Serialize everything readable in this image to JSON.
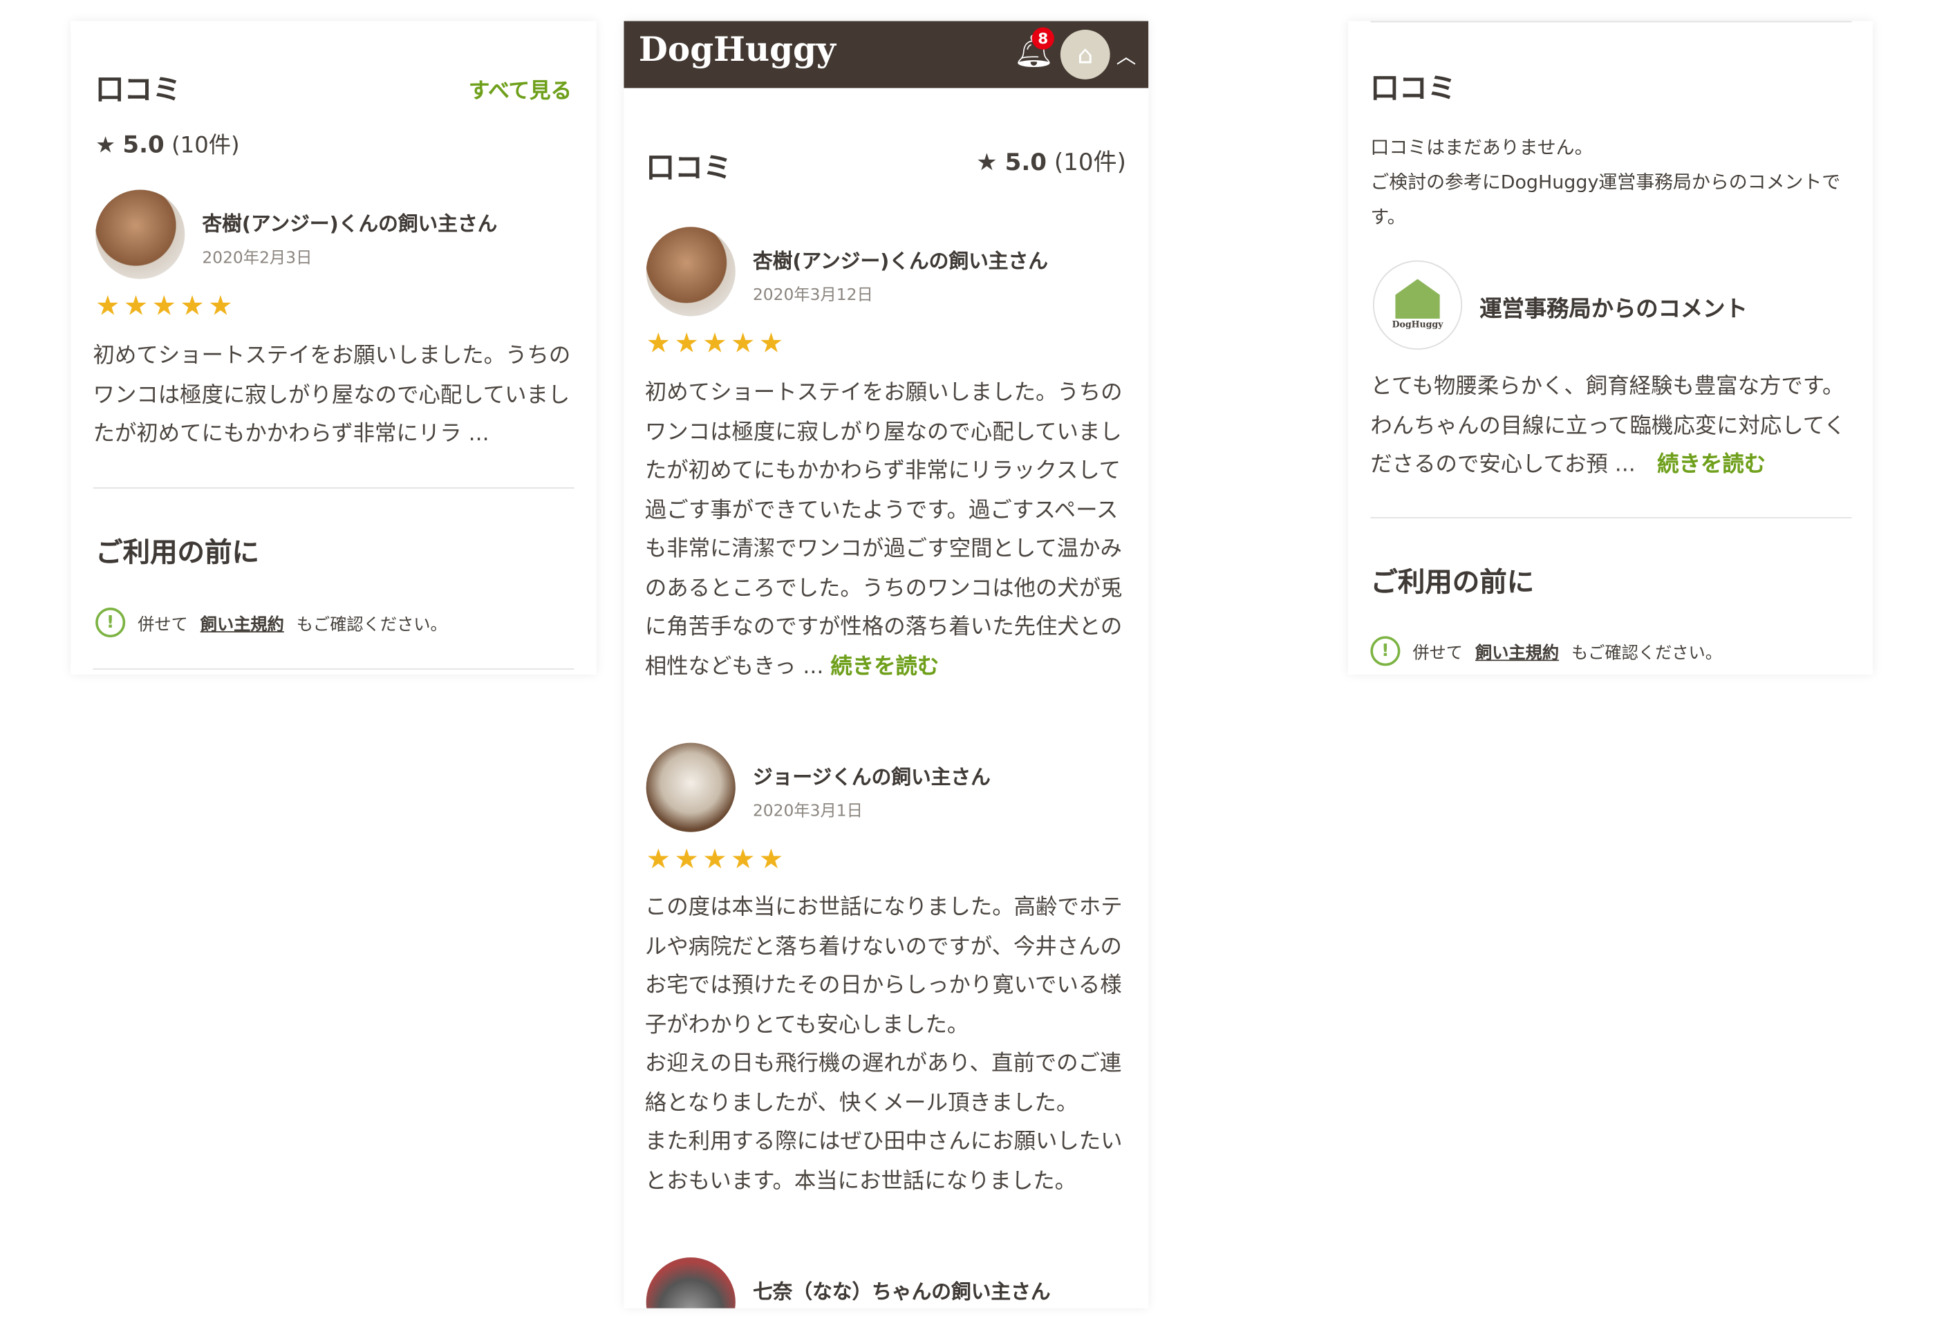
{
  "left": {
    "title": "口コミ",
    "see_all": "すべて見る",
    "rating": "5.0",
    "count": "(10件)",
    "review": {
      "name": "杏樹(アンジー)くんの飼い主さん",
      "date": "2020年2月3日",
      "stars": "★★★★★",
      "text": "初めてショートステイをお願いしました。うちのワンコは極度に寂しがり屋なので心配していましたが初めてにもかかわらず非常にリラ ..."
    },
    "before_title": "ご利用の前に",
    "notice": {
      "prefix": "併せて",
      "link": "飼い主規約",
      "suffix": "もご確認ください。"
    }
  },
  "middle": {
    "logo": "DogHuggy",
    "notification_count": "8",
    "title": "口コミ",
    "rating": "5.0",
    "count": "(10件)",
    "reviews": [
      {
        "name": "杏樹(アンジー)くんの飼い主さん",
        "date": "2020年3月12日",
        "stars": "★★★★★",
        "text": "初めてショートステイをお願いしました。うちのワンコは極度に寂しがり屋なので心配していましたが初めてにもかかわらず非常にリラックスして過ごす事ができていたようです。過ごすスペースも非常に清潔でワンコが過ごす空間として温かみのあるところでした。うちのワンコは他の犬が兎に角苦手なのですが性格の落ち着いた先住犬との相性などもきっ ...",
        "more": "続きを読む"
      },
      {
        "name": "ジョージくんの飼い主さん",
        "date": "2020年3月1日",
        "stars": "★★★★★",
        "text": "この度は本当にお世話になりました。高齢でホテルや病院だと落ち着けないのですが、今井さんのお宅では預けたその日からしっかり寛いでいる様子がわかりとても安心しました。\nお迎えの日も飛行機の遅れがあり、直前でのご連絡となりましたが、快くメール頂きました。\nまた利用する際にはぜひ田中さんにお願いしたいとおもいます。本当にお世話になりました。"
      },
      {
        "name": "七奈（なな）ちゃんの飼い主さん"
      }
    ]
  },
  "right": {
    "title": "口コミ",
    "empty": "口コミはまだありません。",
    "intro": "ご検討の参考にDogHuggy運営事務局からのコメントです。",
    "comment_title": "運営事務局からのコメント",
    "comment_logo": "DogHuggy",
    "comment": "とても物腰柔らかく、飼育経験も豊富な方です。わんちゃんの目線に立って臨機応変に対応してくださるので安心してお預 ...",
    "more": "続きを読む",
    "before_title": "ご利用の前に",
    "notice": {
      "prefix": "併せて",
      "link": "飼い主規約",
      "suffix": "もご確認ください。"
    }
  },
  "colors": {
    "header": "#433832",
    "accent": "#6fa01c",
    "star": "#f0b31d",
    "badge": "#e60012"
  }
}
